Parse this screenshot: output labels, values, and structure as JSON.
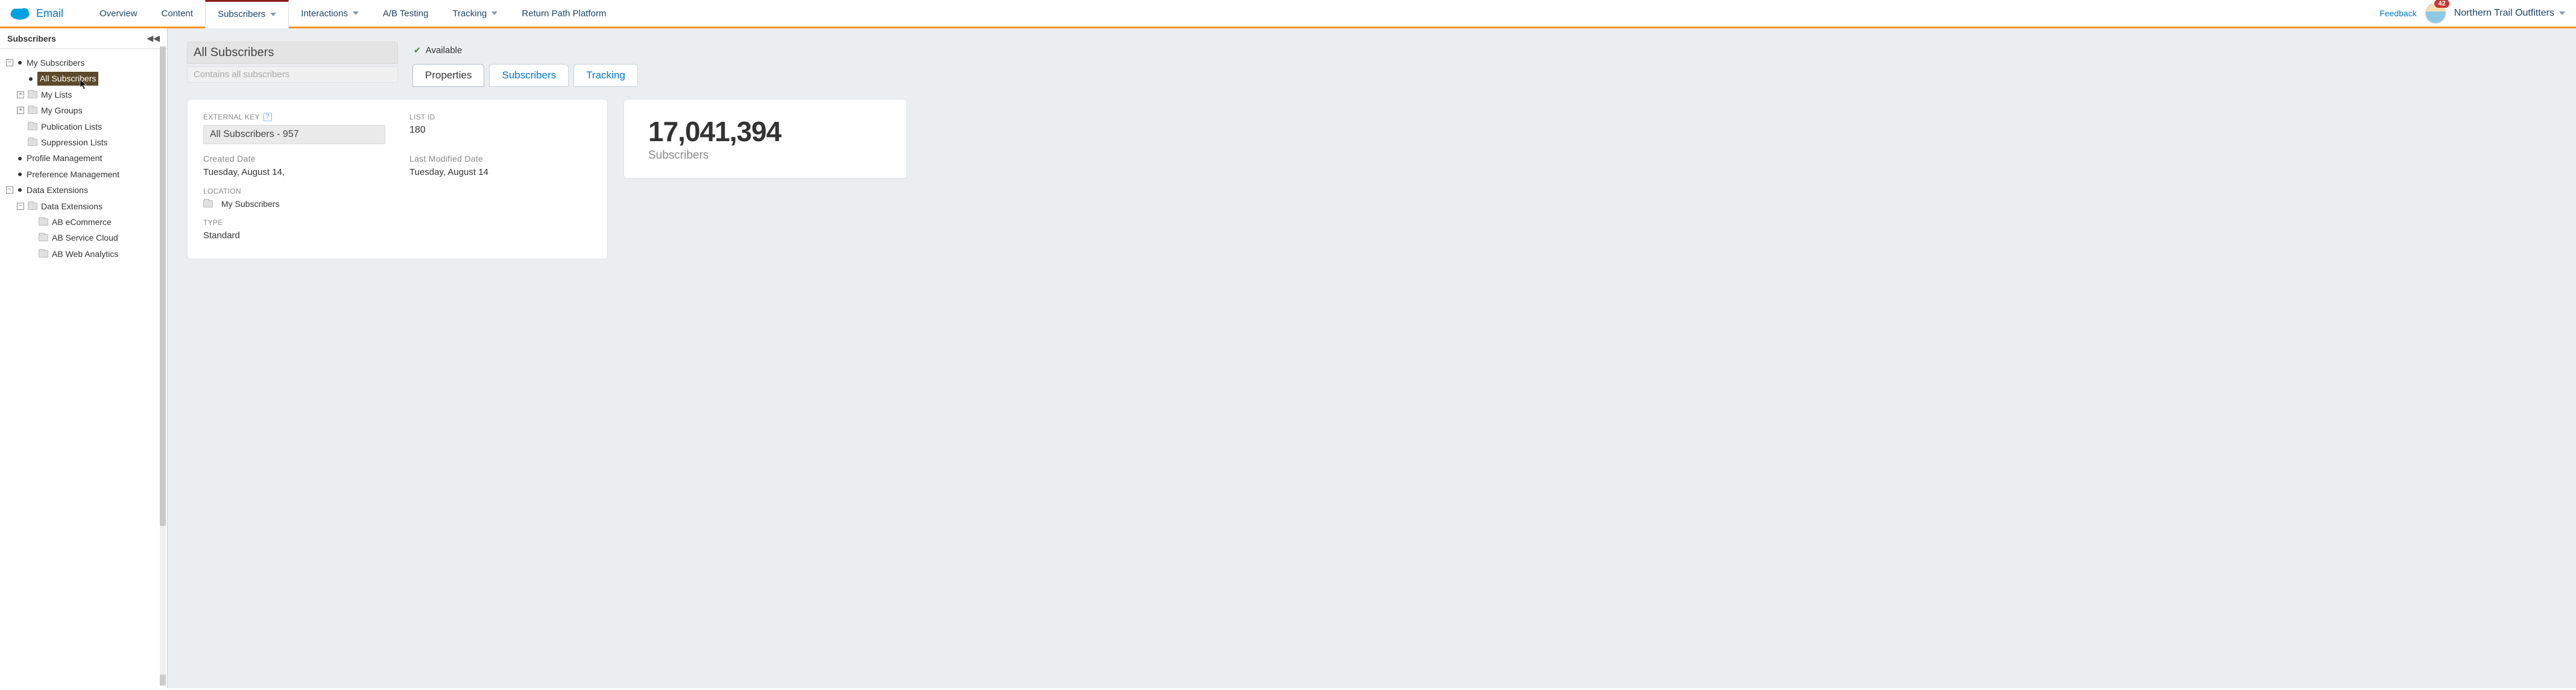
{
  "app_name": "Email",
  "nav": {
    "tabs": [
      {
        "label": "Overview",
        "dd": false
      },
      {
        "label": "Content",
        "dd": false
      },
      {
        "label": "Subscribers",
        "dd": true,
        "active": true
      },
      {
        "label": "Interactions",
        "dd": true
      },
      {
        "label": "A/B Testing",
        "dd": false
      },
      {
        "label": "Tracking",
        "dd": true
      },
      {
        "label": "Return Path Platform",
        "dd": false
      }
    ],
    "feedback": "Feedback",
    "badge": "42",
    "org": "Northern Trail Outfitters"
  },
  "sidebar": {
    "title": "Subscribers",
    "nodes": {
      "my_subscribers": "My Subscribers",
      "all_subscribers": "All Subscribers",
      "my_lists": "My Lists",
      "my_groups": "My Groups",
      "publication_lists": "Publication Lists",
      "suppression_lists": "Suppression Lists",
      "profile_mgmt": "Profile Management",
      "preference_mgmt": "Preference Management",
      "data_extensions_root": "Data Extensions",
      "data_extensions": "Data Extensions",
      "ab_ecommerce": "AB eCommerce",
      "ab_service_cloud": "AB Service Cloud",
      "ab_web_analytics": "AB Web Analytics"
    }
  },
  "content": {
    "title": "All Subscribers",
    "subtitle": "Contains all subscribers",
    "status": "Available",
    "tabs": {
      "properties": "Properties",
      "subscribers": "Subscribers",
      "tracking": "Tracking"
    },
    "props": {
      "external_key_label": "EXTERNAL KEY",
      "external_key_value": "All Subscribers - 957",
      "list_id_label": "LIST ID",
      "list_id_value": "180",
      "created_label": "Created Date",
      "created_value": "Tuesday, August 14,",
      "modified_label": "Last Modified Date",
      "modified_value": "Tuesday, August 14",
      "location_label": "LOCATION",
      "location_value": "My Subscribers",
      "type_label": "TYPE",
      "type_value": "Standard"
    },
    "count": {
      "value": "17,041,394",
      "label": "Subscribers"
    }
  }
}
